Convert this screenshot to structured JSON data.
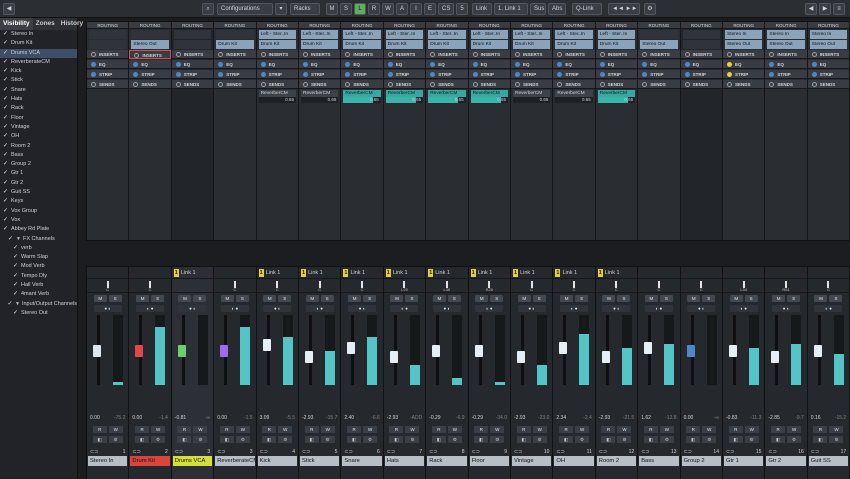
{
  "toolbar": {
    "configurations": "Configurations",
    "racks": "Racks",
    "link": "Link",
    "link_sel": "1. Link 1",
    "sus": "Sus",
    "abs": "Abs",
    "qlink": "Q-Link",
    "btn_m": "M",
    "btn_s": "S",
    "btn_l": "L",
    "btn_r": "R",
    "btn_w": "W",
    "btn_a": "A",
    "btn_i": "I",
    "btn_e": "E",
    "btn_cs": "CS",
    "btn_5": "5",
    "left_arrow": "◀",
    "right_arrow": "▶"
  },
  "left": {
    "tabs": [
      "Visibility",
      "Zones",
      "History"
    ],
    "items": [
      {
        "label": "Stereo In",
        "check": "✓",
        "indent": 0,
        "sel": false
      },
      {
        "label": "Drum Kit",
        "check": "✓",
        "indent": 0,
        "sel": false
      },
      {
        "label": "Drums VCA",
        "check": "✓",
        "indent": 0,
        "sel": true
      },
      {
        "label": "ReverberateCM",
        "check": "✓",
        "indent": 0,
        "sel": false
      },
      {
        "label": "Kick",
        "check": "✓",
        "indent": 0,
        "sel": false
      },
      {
        "label": "Stick",
        "check": "✓",
        "indent": 0,
        "sel": false
      },
      {
        "label": "Snare",
        "check": "✓",
        "indent": 0,
        "sel": false
      },
      {
        "label": "Hats",
        "check": "✓",
        "indent": 0,
        "sel": false
      },
      {
        "label": "Rack",
        "check": "✓",
        "indent": 0,
        "sel": false
      },
      {
        "label": "Floor",
        "check": "✓",
        "indent": 0,
        "sel": false
      },
      {
        "label": "Vintage",
        "check": "✓",
        "indent": 0,
        "sel": false
      },
      {
        "label": "OH",
        "check": "✓",
        "indent": 0,
        "sel": false
      },
      {
        "label": "Room 2",
        "check": "✓",
        "indent": 0,
        "sel": false
      },
      {
        "label": "Bass",
        "check": "✓",
        "indent": 0,
        "sel": false
      },
      {
        "label": "Group 2",
        "check": "✓",
        "indent": 0,
        "sel": false
      },
      {
        "label": "Gtr 1",
        "check": "✓",
        "indent": 0,
        "sel": false
      },
      {
        "label": "Gtr 2",
        "check": "✓",
        "indent": 0,
        "sel": false
      },
      {
        "label": "Guit SS",
        "check": "✓",
        "indent": 0,
        "sel": false
      },
      {
        "label": "Keys",
        "check": "✓",
        "indent": 0,
        "sel": false
      },
      {
        "label": "Vox Group",
        "check": "✓",
        "indent": 0,
        "sel": false
      },
      {
        "label": "Vox",
        "check": "✓",
        "indent": 0,
        "sel": false
      },
      {
        "label": "Abbey Rd Plate",
        "check": "✓",
        "indent": 0,
        "sel": false
      },
      {
        "label": "FX Channels",
        "check": "✓",
        "indent": 1,
        "sel": false,
        "group": true
      },
      {
        "label": "verb",
        "check": "✓",
        "indent": 2,
        "sel": false
      },
      {
        "label": "Warm Slap",
        "check": "✓",
        "indent": 2,
        "sel": false
      },
      {
        "label": "Mod Verb",
        "check": "✓",
        "indent": 2,
        "sel": false
      },
      {
        "label": "Tempo Dly",
        "check": "✓",
        "indent": 2,
        "sel": false
      },
      {
        "label": "Hall Verb",
        "check": "✓",
        "indent": 2,
        "sel": false
      },
      {
        "label": "4mant Verb",
        "check": "✓",
        "indent": 2,
        "sel": false
      },
      {
        "label": "Input/Output Channels",
        "check": "✓",
        "indent": 1,
        "sel": false,
        "group": true
      },
      {
        "label": "Stereo Out",
        "check": "✓",
        "indent": 2,
        "sel": false
      }
    ]
  },
  "rack_labels": {
    "routing": "ROUTING",
    "inserts": "INSERTS",
    "eq": "EQ",
    "strip": "STRIP",
    "sends": "SENDS"
  },
  "channels": [
    {
      "name": "Stereo In",
      "idx": "1",
      "route_in": "",
      "route_out": "",
      "send": "",
      "send_val": "",
      "send_fill": 0,
      "link": "",
      "pan": "C",
      "vol": "0.00",
      "peak": "-75.2",
      "fader": 0.0,
      "meter": 0.05,
      "color": "#8a98a8",
      "namebg": "#b7bec6",
      "selected": false,
      "dark": false,
      "cap": "#dde6ee"
    },
    {
      "name": "Drum Kit",
      "idx": "2",
      "route_in": "",
      "route_out": "Stereo Out",
      "send": "",
      "send_val": "",
      "send_fill": 0,
      "link": "",
      "pan": "C",
      "vol": "0.00",
      "peak": "-1.4",
      "fader": 0.0,
      "meter": 0.85,
      "color": "#c0392b",
      "namebg": "#d9453a",
      "selected": false,
      "dark": false,
      "cap": "#e0484e"
    },
    {
      "name": "Drums VCA",
      "idx": "3",
      "route_in": "",
      "route_out": "",
      "send": "",
      "send_val": "",
      "send_fill": 0,
      "link": "Link 1",
      "pan": "",
      "vol": "-0.81",
      "peak": "-∞",
      "fader": 0.0,
      "meter": 0,
      "color": "#c9d23a",
      "namebg": "#d5df3c",
      "selected": true,
      "dark": true,
      "cap": "#6ccf6c"
    },
    {
      "name": "ReverberateCM",
      "idx": "3",
      "route_in": "",
      "route_out": "Drum Kit",
      "send": "",
      "send_val": "",
      "send_fill": 0,
      "link": "",
      "pan": "C",
      "vol": "0.00",
      "peak": "-1.5",
      "fader": 0.0,
      "meter": 0.85,
      "color": "#8c5bd6",
      "namebg": "#b7bec6",
      "selected": false,
      "dark": false,
      "cap": "#9b6cf0"
    },
    {
      "name": "Kick",
      "idx": "4",
      "route_in": "Left - Ster..In",
      "route_out": "Drum Kit",
      "send": "ReverberCM",
      "send_val": "0.65",
      "send_fill": 0,
      "link": "Link 1",
      "pan": "C",
      "vol": "3.09",
      "peak": "-5.5",
      "fader": 0.1,
      "meter": 0.7,
      "color": "#5aa0d8",
      "namebg": "#b7bec6",
      "selected": false,
      "dark": false,
      "cap": "#e6eef5"
    },
    {
      "name": "Stick",
      "idx": "5",
      "route_in": "Left - Ster..In",
      "route_out": "Drum Kit",
      "send": "ReverberCM",
      "send_val": "0.65",
      "send_fill": 0,
      "link": "Link 1",
      "pan": "C",
      "vol": "-2.93",
      "peak": "-15.7",
      "fader": -0.1,
      "meter": 0.5,
      "color": "#5aa0d8",
      "namebg": "#b7bec6",
      "selected": false,
      "dark": false,
      "cap": "#e6eef5"
    },
    {
      "name": "Snare",
      "idx": "6",
      "route_in": "Left - Ster..In",
      "route_out": "Drum Kit",
      "send": "ReverberCM",
      "send_val": "0.65",
      "send_fill": 1,
      "link": "Link 1",
      "pan": "C",
      "vol": "2.40",
      "peak": "-6.6",
      "fader": 0.05,
      "meter": 0.7,
      "color": "#5aa0d8",
      "namebg": "#b7bec6",
      "selected": false,
      "dark": false,
      "cap": "#e6eef5"
    },
    {
      "name": "Hats",
      "idx": "7",
      "route_in": "Left - Ster..In",
      "route_out": "Drum Kit",
      "send": "ReverberCM",
      "send_val": "0.65",
      "send_fill": 1,
      "link": "Link 1",
      "pan": "L20",
      "vol": "-2.93",
      "peak": "-ADD",
      "fader": -0.1,
      "meter": 0.3,
      "color": "#5aa0d8",
      "namebg": "#b7bec6",
      "selected": false,
      "dark": false,
      "cap": "#e6eef5"
    },
    {
      "name": "Rack",
      "idx": "8",
      "route_in": "Left - Ster..In",
      "route_out": "Drum Kit",
      "send": "ReverberCM",
      "send_val": "0.65",
      "send_fill": 1,
      "link": "Link 1",
      "pan": "L36",
      "vol": "-0.29",
      "peak": "-6.9",
      "fader": 0.0,
      "meter": 0.1,
      "color": "#5aa0d8",
      "namebg": "#b7bec6",
      "selected": false,
      "dark": false,
      "cap": "#e6eef5"
    },
    {
      "name": "Floor",
      "idx": "9",
      "route_in": "Left - Ster..In",
      "route_out": "Drum Kit",
      "send": "ReverberCM",
      "send_val": "0.65",
      "send_fill": 1,
      "link": "Link 1",
      "pan": "R25",
      "vol": "-0.29",
      "peak": "-34.0",
      "fader": 0.0,
      "meter": 0.05,
      "color": "#5aa0d8",
      "namebg": "#b7bec6",
      "selected": false,
      "dark": false,
      "cap": "#e6eef5"
    },
    {
      "name": "Vintage",
      "idx": "10",
      "route_in": "Left - Ster..In",
      "route_out": "Drum Kit",
      "send": "ReverberCM",
      "send_val": "0.65",
      "send_fill": 0,
      "link": "Link 1",
      "pan": "C",
      "vol": "-2.93",
      "peak": "-23.0",
      "fader": -0.1,
      "meter": 0.3,
      "color": "#5aa0d8",
      "namebg": "#b7bec6",
      "selected": false,
      "dark": false,
      "cap": "#e6eef5"
    },
    {
      "name": "OH",
      "idx": "11",
      "route_in": "Left - Ster..In",
      "route_out": "Drum Kit",
      "send": "ReverberCM",
      "send_val": "0.65",
      "send_fill": 0,
      "link": "Link 1",
      "pan": "C",
      "vol": "2.34",
      "peak": "-2.4",
      "fader": 0.05,
      "meter": 0.75,
      "color": "#5aa0d8",
      "namebg": "#b7bec6",
      "selected": false,
      "dark": false,
      "cap": "#e6eef5"
    },
    {
      "name": "Room 2",
      "idx": "12",
      "route_in": "Left - Ster..In",
      "route_out": "Drum Kit",
      "send": "ReverberCM",
      "send_val": "0.65",
      "send_fill": 1,
      "link": "Link 1",
      "pan": "C",
      "vol": "-2.93",
      "peak": "-21.5",
      "fader": -0.1,
      "meter": 0.55,
      "color": "#5aa0d8",
      "namebg": "#b7bec6",
      "selected": false,
      "dark": false,
      "cap": "#e6eef5"
    },
    {
      "name": "Bass",
      "idx": "13",
      "route_in": "",
      "route_out": "Stereo Out",
      "send": "",
      "send_val": "",
      "send_fill": 0,
      "link": "",
      "pan": "C",
      "vol": "1.62",
      "peak": "-12.8",
      "fader": 0.05,
      "meter": 0.6,
      "color": "#5aa0d8",
      "namebg": "#b7bec6",
      "selected": false,
      "dark": false,
      "cap": "#e6eef5"
    },
    {
      "name": "Group 2",
      "idx": "14",
      "route_in": "",
      "route_out": "",
      "send": "",
      "send_val": "",
      "send_fill": 0,
      "link": "",
      "pan": "C",
      "vol": "0.00",
      "peak": "-∞",
      "fader": 0.0,
      "meter": 0,
      "color": "#5aa0d8",
      "namebg": "#b7bec6",
      "selected": false,
      "dark": true,
      "cap": "#4b89c9"
    },
    {
      "name": "Gtr 1",
      "idx": "15",
      "route_in": "Stereo In",
      "route_out": "Stereo Out",
      "send": "",
      "send_val": "",
      "send_fill": 0,
      "link": "",
      "pan": "L54",
      "vol": "-0.83",
      "peak": "-11.3",
      "fader": 0.0,
      "meter": 0.55,
      "color": "#5aa0d8",
      "namebg": "#b7bec6",
      "selected": false,
      "dark": false,
      "cap": "#e6eef5"
    },
    {
      "name": "Gtr 2",
      "idx": "16",
      "route_in": "Stereo In",
      "route_out": "Stereo Out",
      "send": "",
      "send_val": "",
      "send_fill": 0,
      "link": "",
      "pan": "R61",
      "vol": "-2.85",
      "peak": "-9.7",
      "fader": -0.1,
      "meter": 0.6,
      "color": "#5aa0d8",
      "namebg": "#b7bec6",
      "selected": false,
      "dark": false,
      "cap": "#e6eef5"
    },
    {
      "name": "Guit SS",
      "idx": "17",
      "route_in": "Stereo In",
      "route_out": "Stereo Out",
      "send": "",
      "send_val": "",
      "send_fill": 0,
      "link": "",
      "pan": "C",
      "vol": "0.16",
      "peak": "-15.2",
      "fader": 0.0,
      "meter": 0.45,
      "color": "#5aa0d8",
      "namebg": "#b7bec6",
      "selected": false,
      "dark": false,
      "cap": "#e6eef5"
    }
  ],
  "fader_labels": {
    "m": "M",
    "s": "S",
    "r": "R",
    "w": "W",
    "a": "A",
    "lock": "◄ ●"
  }
}
